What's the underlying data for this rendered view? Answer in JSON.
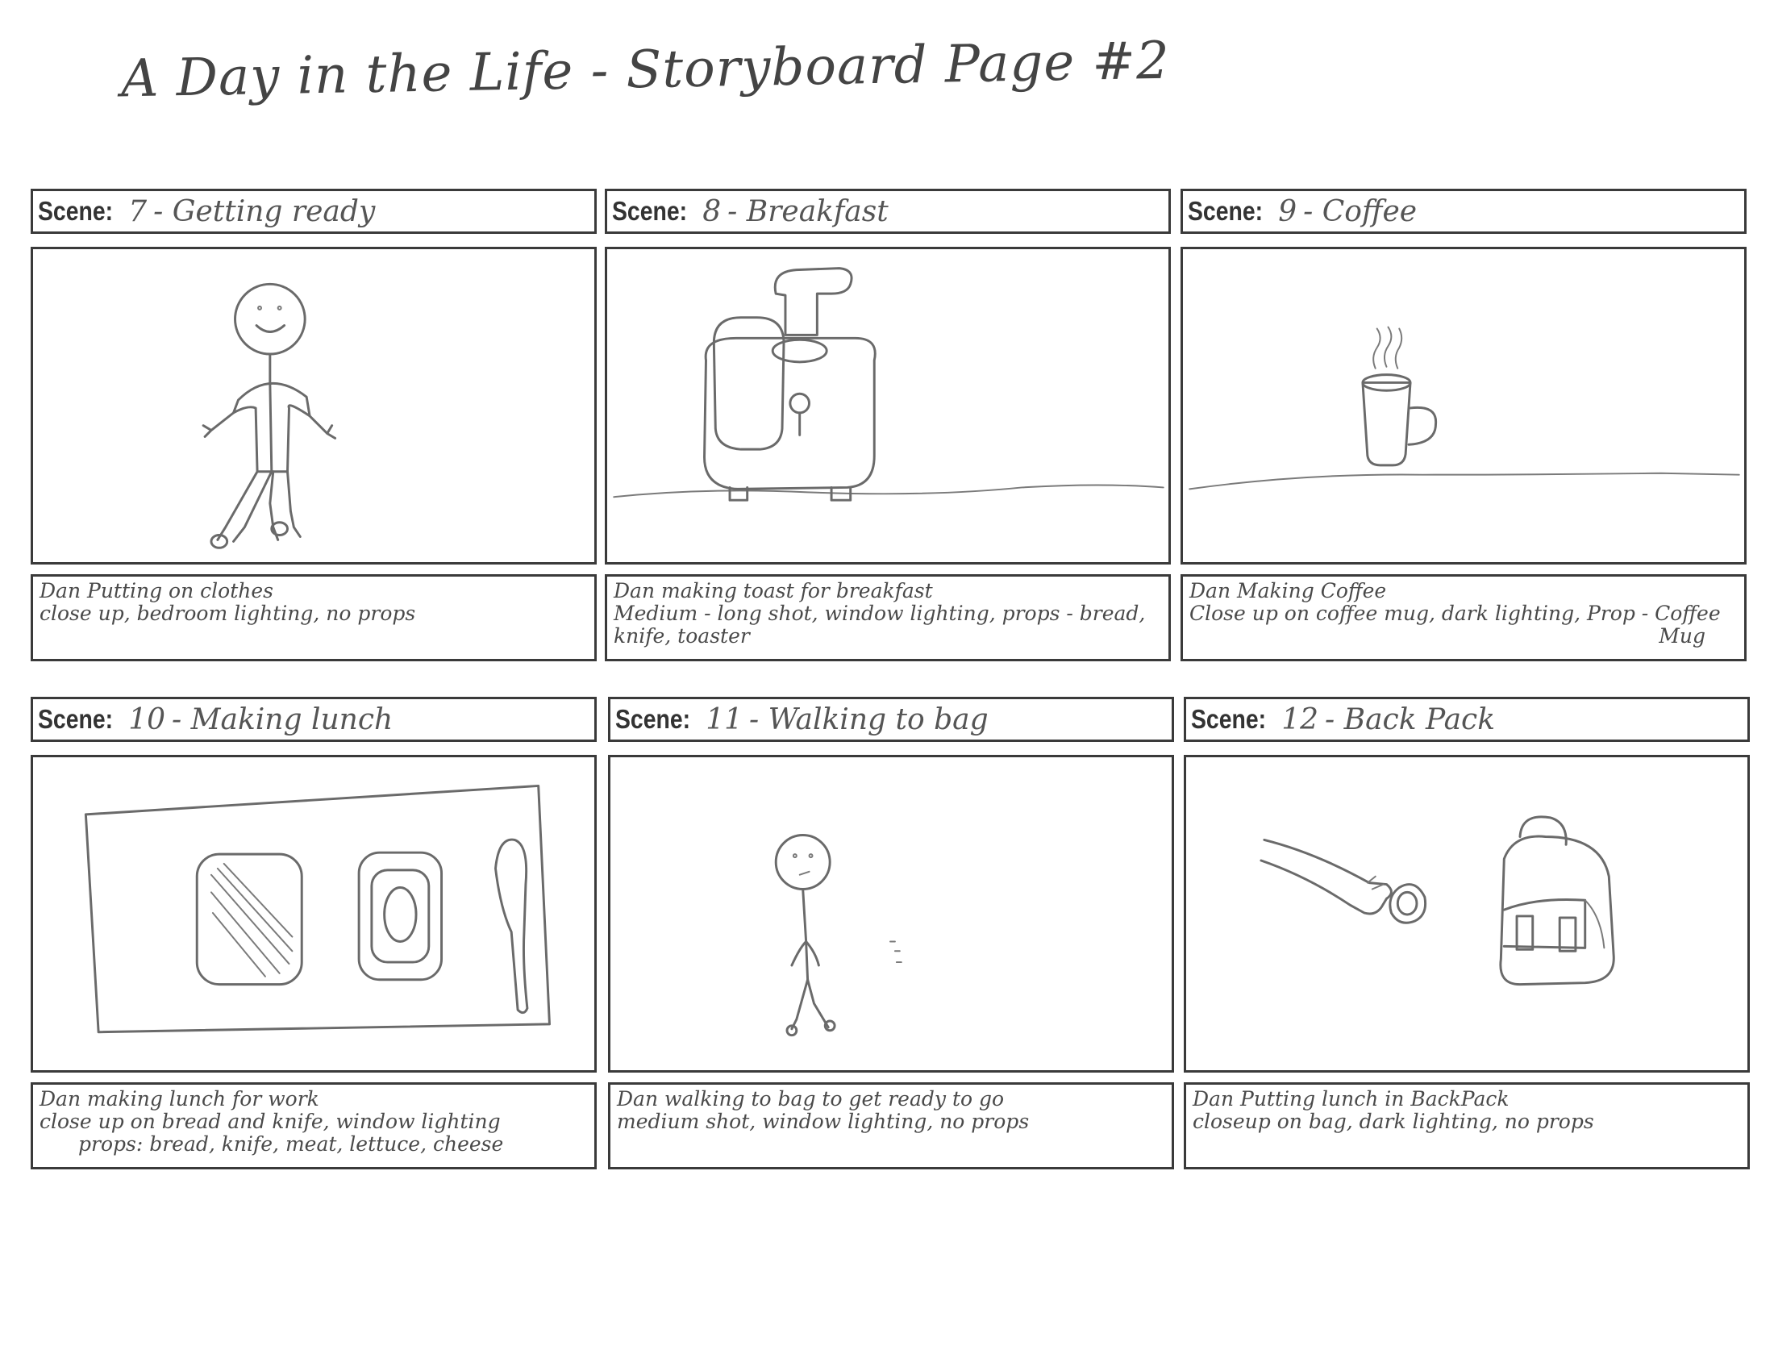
{
  "title": "A Day in the Life - Storyboard Page #2",
  "scene_label": "Scene:",
  "scenes": [
    {
      "number": "7",
      "name": "Getting ready",
      "notes": [
        "Dan Putting on clothes",
        "close up, bedroom lighting, no props"
      ]
    },
    {
      "number": "8",
      "name": "Breakfast",
      "notes": [
        "Dan making toast for breakfast",
        "Medium - long shot, window lighting, props - bread,",
        "knife, toaster"
      ]
    },
    {
      "number": "9",
      "name": "Coffee",
      "notes": [
        "Dan Making Coffee",
        "Close up on coffee mug, dark lighting, Prop - Coffee",
        "Mug"
      ]
    },
    {
      "number": "10",
      "name": "Making lunch",
      "notes": [
        "Dan making lunch for work",
        "close up on bread and knife, window lighting",
        "props: bread, knife, meat, lettuce, cheese"
      ]
    },
    {
      "number": "11",
      "name": "Walking to bag",
      "notes": [
        "Dan walking to bag to get ready to go",
        "medium shot, window lighting, no props"
      ]
    },
    {
      "number": "12",
      "name": "Back Pack",
      "notes": [
        "Dan Putting lunch in BackPack",
        "closeup on bag, dark lighting, no props"
      ]
    }
  ]
}
